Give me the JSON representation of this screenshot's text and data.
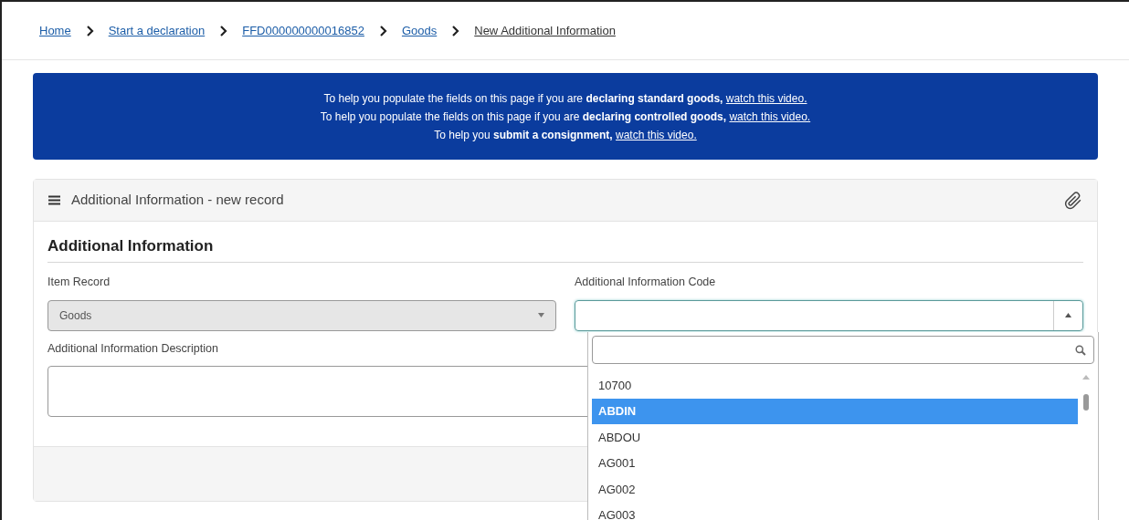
{
  "breadcrumb": [
    {
      "label": "Home",
      "current": false
    },
    {
      "label": "Start a declaration",
      "current": false
    },
    {
      "label": "FFD000000000016852",
      "current": false
    },
    {
      "label": "Goods",
      "current": false
    },
    {
      "label": "New Additional Information",
      "current": true
    }
  ],
  "banner": [
    {
      "text": "To help you populate the fields on this page if you are **declaring standard goods,**",
      "link": "watch this video."
    },
    {
      "text": "To help you populate the fields on this page if you are **declaring controlled goods,**",
      "link": "watch this video."
    },
    {
      "text": "To help you **submit a consignment,**",
      "link": "watch this video."
    }
  ],
  "panel": {
    "title": "Additional Information - new record",
    "section": "Additional Information",
    "item_record": {
      "label": "Item Record",
      "value": "Goods",
      "disabled": true
    },
    "code": {
      "label": "Additional Information Code",
      "expanded": true,
      "options": [
        {
          "label": "10700",
          "selected": false
        },
        {
          "label": "ABDIN",
          "selected": true
        },
        {
          "label": "ABDOU",
          "selected": false
        },
        {
          "label": "AG001",
          "selected": false
        },
        {
          "label": "AG002",
          "selected": false
        },
        {
          "label": "AG003",
          "selected": false
        }
      ]
    },
    "description": {
      "label": "Additional Information Description"
    }
  }
}
